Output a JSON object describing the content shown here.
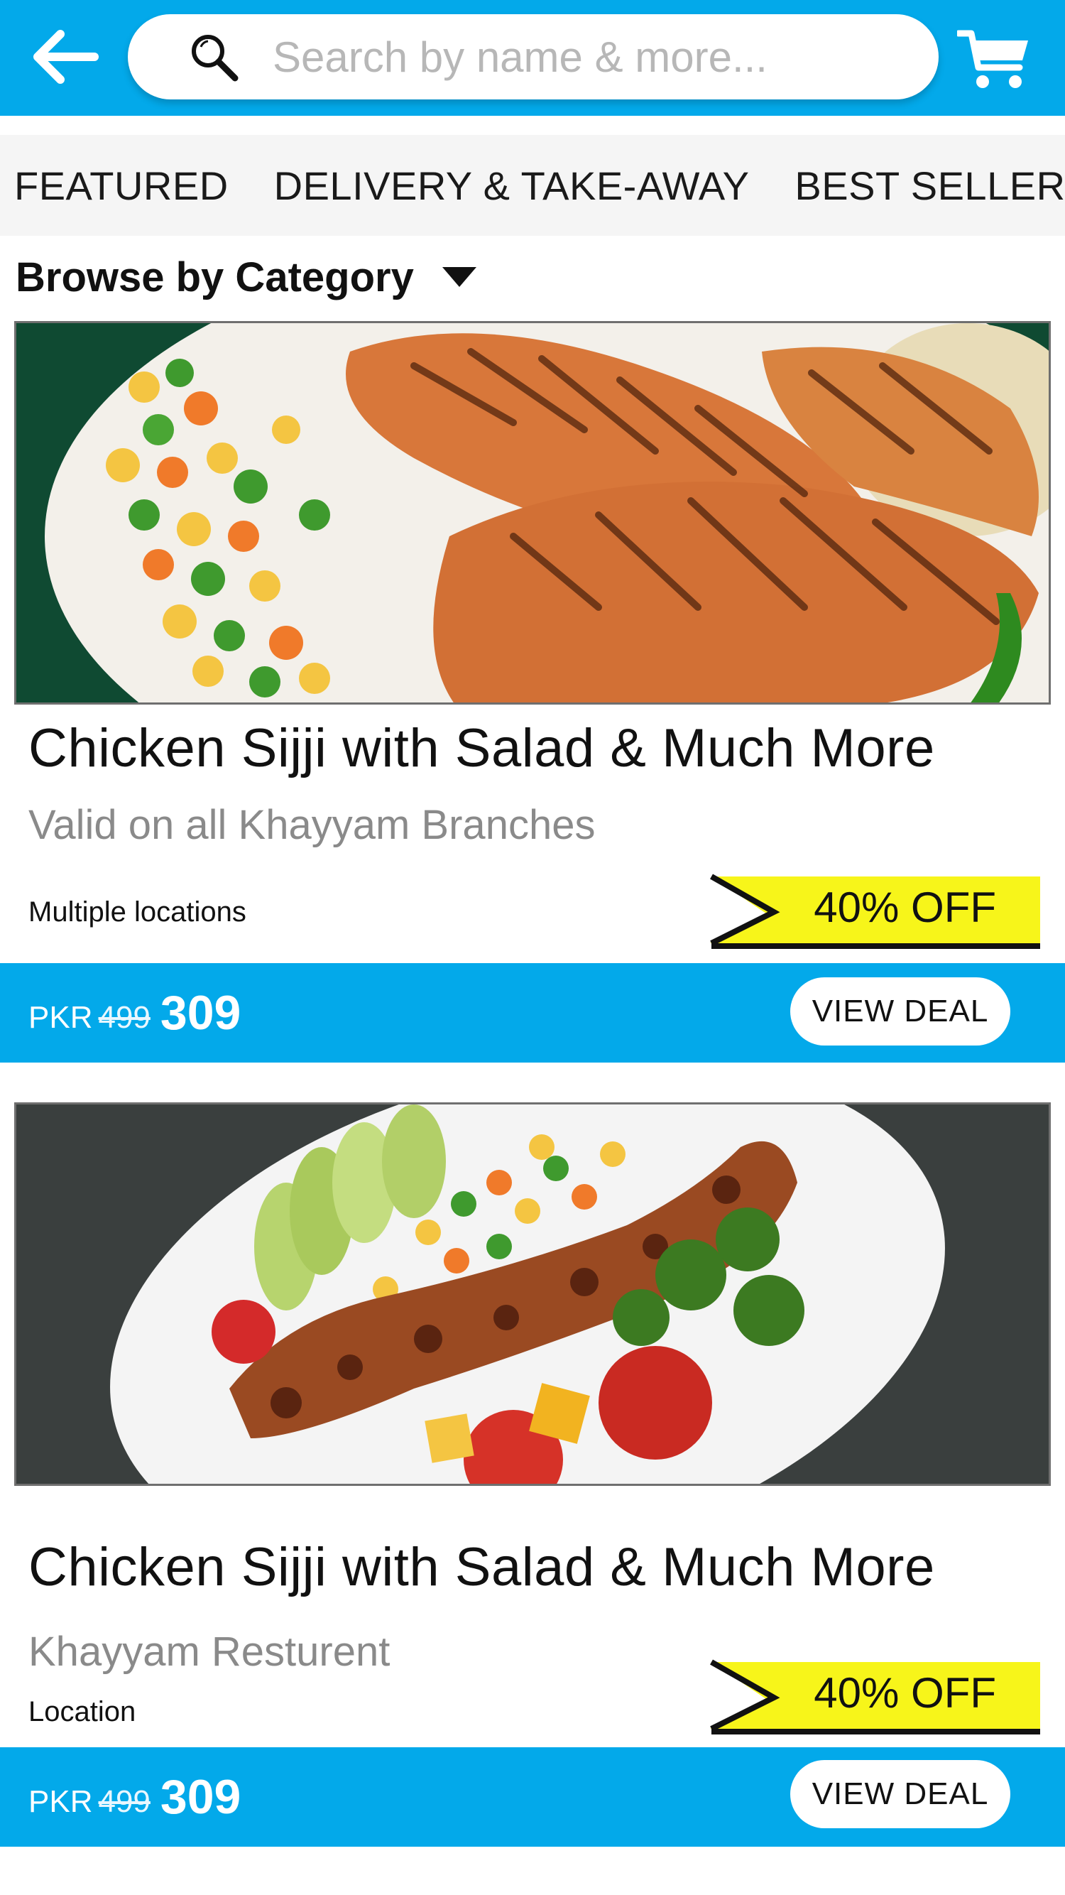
{
  "header": {
    "search_placeholder": "Search by name & more...",
    "back_icon": "arrow-left-icon",
    "search_icon": "search-icon",
    "cart_icon": "cart-icon",
    "accent_color": "#03a9ea"
  },
  "tabs": [
    {
      "label": "FEATURED"
    },
    {
      "label": "DELIVERY & TAKE-AWAY"
    },
    {
      "label": "BEST SELLERS"
    }
  ],
  "browse": {
    "label": "Browse by Category"
  },
  "deals": [
    {
      "title": "Chicken Sijji with Salad & Much More",
      "subtitle": "Valid on all Khayyam Branches",
      "location": "Multiple locations",
      "discount": "40% OFF",
      "currency": "PKR",
      "old_price": "499",
      "new_price": "309",
      "button": "VIEW DEAL"
    },
    {
      "title": "Chicken Sijji with Salad & Much More",
      "subtitle": "Khayyam Resturent",
      "location": "Location",
      "discount": "40% OFF",
      "currency": "PKR",
      "old_price": "499",
      "new_price": "309",
      "button": "VIEW DEAL"
    }
  ]
}
